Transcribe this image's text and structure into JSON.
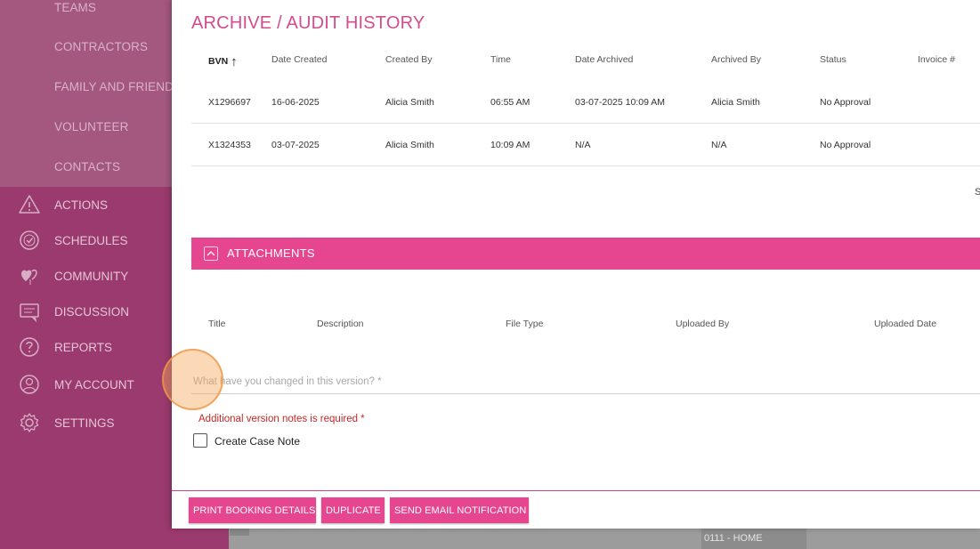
{
  "sidebar": {
    "sub_items": [
      "TEAMS",
      "CONTRACTORS",
      "FAMILY AND FRIENDS",
      "VOLUNTEER",
      "CONTACTS"
    ],
    "nav_items": [
      {
        "label": "ACTIONS",
        "icon": "warning-triangle-icon"
      },
      {
        "label": "SCHEDULES",
        "icon": "clock-icon"
      },
      {
        "label": "COMMUNITY",
        "icon": "hearts-icon"
      },
      {
        "label": "DISCUSSION",
        "icon": "chat-icon"
      },
      {
        "label": "REPORTS",
        "icon": "reports-icon"
      },
      {
        "label": "MY ACCOUNT",
        "icon": "user-icon"
      },
      {
        "label": "SETTINGS",
        "icon": "gear-icon"
      }
    ]
  },
  "modal": {
    "title": "ARCHIVE / AUDIT HISTORY",
    "audit_table": {
      "columns": [
        "BVN",
        "Date Created",
        "Created By",
        "Time",
        "Date Archived",
        "Archived By",
        "Status",
        "Invoice #"
      ],
      "sort_icon": "arrow-up-icon",
      "rows": [
        [
          "X1296697",
          "16-06-2025",
          "Alicia Smith",
          "06:55 AM",
          "03-07-2025 10:09 AM",
          "Alicia Smith",
          "No Approval",
          ""
        ],
        [
          "X1324353",
          "03-07-2025",
          "Alicia Smith",
          "10:09 AM",
          "N/A",
          "N/A",
          "No Approval",
          ""
        ]
      ],
      "partial_text": "S"
    },
    "attachments": {
      "label": "ATTACHMENTS",
      "toggle_icon": "chevron-up-icon",
      "columns": [
        "Title",
        "Description",
        "File Type",
        "Uploaded By",
        "Uploaded Date"
      ]
    },
    "version_field": {
      "placeholder": "What have you changed in this version? *",
      "value": ""
    },
    "error_text": "Additional version notes is required *",
    "case_note": {
      "label": "Create Case Note",
      "checked": false
    },
    "buttons": {
      "print": "PRINT BOOKING DETAILS",
      "duplicate": "DUPLICATE",
      "send_email": "SEND EMAIL NOTIFICATION"
    }
  },
  "background": {
    "cell_text": "0111 - HOME"
  },
  "colors": {
    "accent": "#e5468f",
    "title": "#d14d8e",
    "sidebar": "#9a3a6e",
    "sidebar_upper": "#a4577f",
    "error": "#c62828"
  }
}
